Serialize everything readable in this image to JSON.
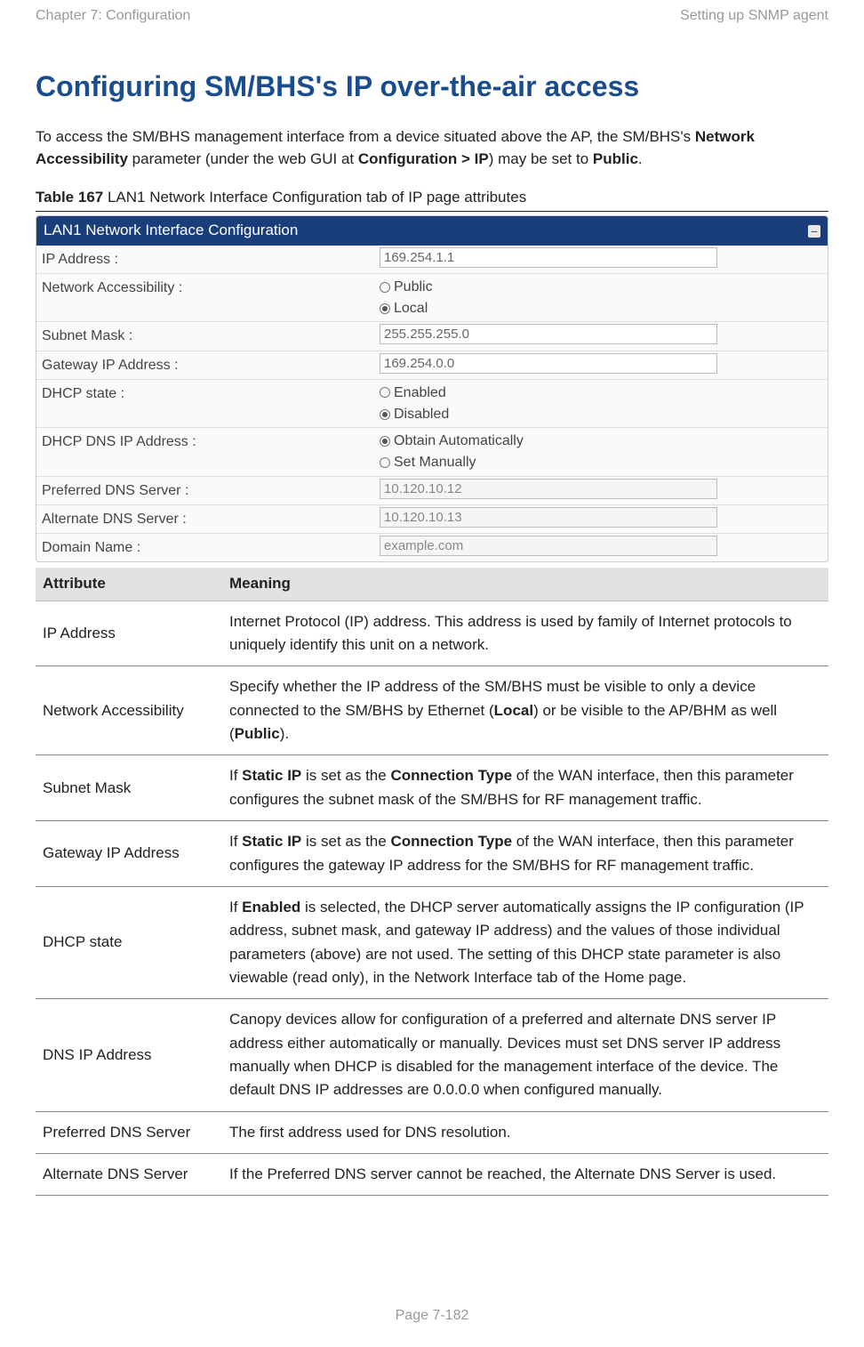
{
  "header": {
    "left": "Chapter 7:  Configuration",
    "right": "Setting up SNMP agent"
  },
  "title": "Configuring SM/BHS's IP over-the-air access",
  "intro_parts": {
    "p1": "To access the SM/BHS management interface from a device situated above the AP, the SM/BHS's ",
    "b1": "Network Accessibility",
    "p2": " parameter (under the web GUI at ",
    "b2": "Configuration > IP",
    "p3": ") may be set to ",
    "b3": "Public",
    "p4": "."
  },
  "caption": {
    "bold": "Table 167",
    "rest": " LAN1 Network Interface Configuration tab of IP page attributes"
  },
  "panel": {
    "title": "LAN1 Network Interface Configuration",
    "rows": {
      "ip_label": "IP Address :",
      "ip_val": "169.254.1.1",
      "na_label": "Network Accessibility :",
      "na_public": "Public",
      "na_local": "Local",
      "sm_label": "Subnet Mask :",
      "sm_val": "255.255.255.0",
      "gw_label": "Gateway IP Address :",
      "gw_val": "169.254.0.0",
      "dhcp_label": "DHCP state :",
      "dhcp_en": "Enabled",
      "dhcp_dis": "Disabled",
      "dns_label": "DHCP DNS IP Address :",
      "dns_auto": "Obtain Automatically",
      "dns_man": "Set Manually",
      "pdns_label": "Preferred DNS Server :",
      "pdns_val": "10.120.10.12",
      "adns_label": "Alternate DNS Server :",
      "adns_val": "10.120.10.13",
      "dom_label": "Domain Name :",
      "dom_val": "example.com"
    }
  },
  "table": {
    "h1": "Attribute",
    "h2": "Meaning",
    "rows": [
      {
        "attr": "IP Address",
        "html": "Internet Protocol (IP) address. This address is used by family of Internet protocols to uniquely identify this unit on a network."
      },
      {
        "attr": "Network Accessibility",
        "html": "Specify whether the IP address of the SM/BHS must be visible to only a device connected to the SM/BHS by Ethernet (<b>Local</b>) or be visible to the AP/BHM as well (<b>Public</b>)."
      },
      {
        "attr": "Subnet Mask",
        "html": "If <b>Static IP</b> is set as the <b>Connection Type</b> of the WAN interface, then this parameter configures the subnet mask of the SM/BHS for RF management traffic."
      },
      {
        "attr": "Gateway IP Address",
        "html": "If <b>Static IP</b> is set as the <b>Connection Type</b> of the WAN interface, then this parameter configures the gateway IP address for the SM/BHS for RF management traffic."
      },
      {
        "attr": "DHCP state",
        "html": "If <b>Enabled</b> is selected, the DHCP server automatically assigns the IP configuration (IP address, subnet mask, and gateway IP address) and the values of those individual parameters (above) are not used. The setting of this DHCP state parameter is also viewable (read only), in the Network Interface tab of the Home page."
      },
      {
        "attr": "DNS IP Address",
        "html": "Canopy devices allow for configuration of a preferred and alternate DNS server IP address either automatically or manually. Devices must set DNS server IP address manually when DHCP is disabled for the management interface of the device. The default DNS IP addresses are 0.0.0.0 when configured manually."
      },
      {
        "attr": "Preferred DNS Server",
        "html": "The first address used for DNS resolution."
      },
      {
        "attr": "Alternate DNS Server",
        "html": "If the Preferred DNS server cannot be reached, the Alternate DNS Server is used."
      }
    ]
  },
  "footer": "Page 7-182"
}
